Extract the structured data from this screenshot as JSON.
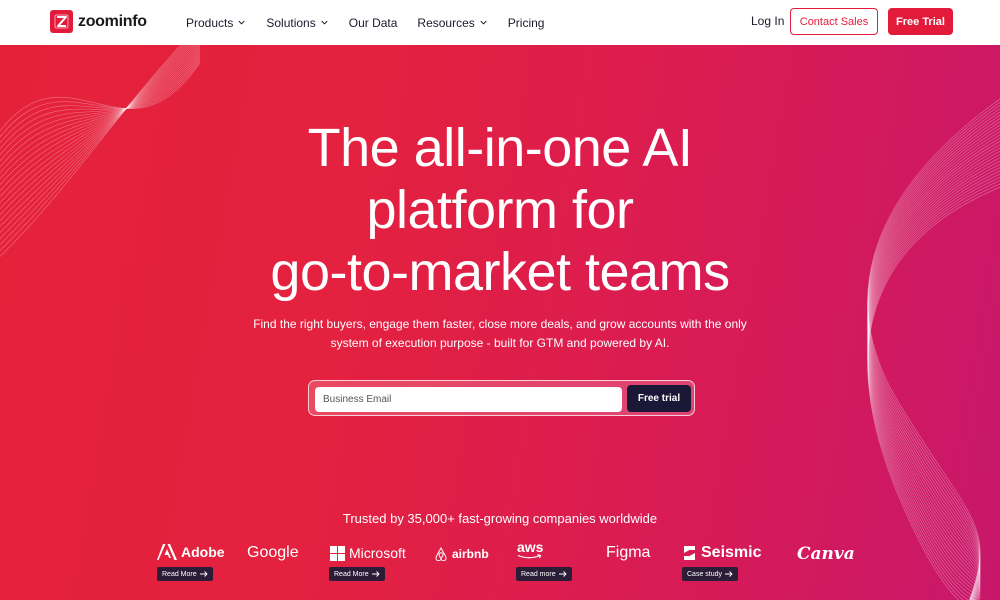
{
  "header": {
    "logo_text": "zoominfo",
    "nav": [
      {
        "label": "Products",
        "has_dropdown": true
      },
      {
        "label": "Solutions",
        "has_dropdown": true
      },
      {
        "label": "Our Data",
        "has_dropdown": false
      },
      {
        "label": "Resources",
        "has_dropdown": true
      },
      {
        "label": "Pricing",
        "has_dropdown": false
      }
    ],
    "login_label": "Log In",
    "contact_label": "Contact Sales",
    "trial_label": "Free Trial"
  },
  "hero": {
    "headline_line1": "The all-in-one AI",
    "headline_line2": "platform for",
    "headline_line3": "go-to-market teams",
    "sub_line1": "Find the right buyers, engage them faster, close more deals, and grow accounts with the only",
    "sub_line2": "system of execution purpose - built for GTM and powered by AI.",
    "email_placeholder": "Business Email",
    "form_button": "Free trial",
    "trusted_text": "Trusted by 35,000+ fast-growing companies worldwide"
  },
  "logos": [
    {
      "name": "Adobe",
      "link": "Read More"
    },
    {
      "name": "Google",
      "link": ""
    },
    {
      "name": "Microsoft",
      "link": "Read More"
    },
    {
      "name": "airbnb",
      "link": ""
    },
    {
      "name": "aws",
      "link": "Read more"
    },
    {
      "name": "Figma",
      "link": ""
    },
    {
      "name": "Seismic",
      "link": "Case study"
    },
    {
      "name": "Canva",
      "link": ""
    }
  ],
  "colors": {
    "brand_red": "#e31b3b",
    "dark_button": "#1b1736",
    "white": "#ffffff"
  }
}
